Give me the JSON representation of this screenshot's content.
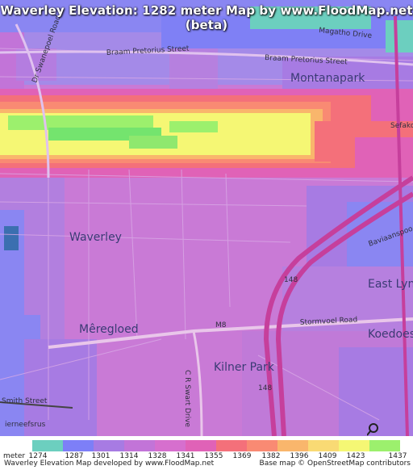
{
  "title": "Waverley Elevation: 1282 meter Map by www.FloodMap.net (beta)",
  "map": {
    "place_labels": [
      "Montanapark",
      "Waverley",
      "Mêregloed",
      "East Lynn",
      "Koedoespo",
      "Kilner Park",
      "ierneefsrus"
    ],
    "street_labels": [
      "Braam Pretorius Street",
      "Braam Pretorius Street",
      "Dr Swanepoel Road",
      "Stormvoel Road",
      "C R Swart Drive",
      "Smith Street",
      "Baviaanspoo",
      "Sefako",
      "Magatho Drive",
      "M8"
    ],
    "route_labels": [
      "148",
      "148"
    ],
    "attribution_logo": "OpenStreetMap"
  },
  "legend": {
    "unit_label": "meter",
    "values": [
      "1274",
      "1287",
      "1301",
      "1314",
      "1328",
      "1341",
      "1355",
      "1369",
      "1382",
      "1396",
      "1409",
      "1423",
      "1437"
    ],
    "colors": [
      "#6ccfbf",
      "#7d7ff7",
      "#a77be3",
      "#c274d8",
      "#d66fce",
      "#e062b7",
      "#f4707a",
      "#f98a73",
      "#f9b66c",
      "#f9da74",
      "#f5f774",
      "#9cf06d",
      "#74e46e"
    ]
  },
  "footer": {
    "left": "Waverley Elevation Map developed by www.FloodMap.net",
    "right": "Base map © OpenStreetMap contributors"
  }
}
